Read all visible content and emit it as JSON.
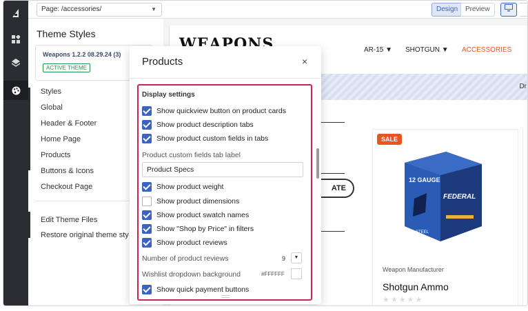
{
  "topbar": {
    "page_select": "Page: /accessories/",
    "design_label": "Design",
    "preview_label": "Preview"
  },
  "sidebar": {
    "title": "Theme Styles",
    "theme_name": "Weapons 1.2.2 08.29.24 (3)",
    "active_badge": "ACTIVE THEME",
    "items": [
      {
        "label": "Styles"
      },
      {
        "label": "Global"
      },
      {
        "label": "Header & Footer"
      },
      {
        "label": "Home Page"
      },
      {
        "label": "Products"
      },
      {
        "label": "Buttons & Icons"
      },
      {
        "label": "Checkout Page"
      },
      {
        "label": "Edit Theme Files"
      },
      {
        "label": "Restore original theme sty"
      }
    ]
  },
  "store": {
    "logo": "WEAPONS",
    "nav": [
      "AR-15 ▼",
      "SHOTGUN ▼",
      "ACCESSORIES"
    ],
    "stripe_text": "Dr",
    "button_fragment": "ATE",
    "product": {
      "badge": "SALE",
      "manufacturer": "Weapon Manufacturer",
      "name": "Shotgun Ammo",
      "stars": "★★★★★",
      "box_brand": "FEDERAL",
      "box_gauge": "12 GAUGE",
      "box_bottom": "2¾ STEEL"
    }
  },
  "modal": {
    "title": "Products",
    "close_icon": "×",
    "section_title": "Display settings",
    "options_top": [
      {
        "label": "Show quickview button on product cards",
        "checked": true
      },
      {
        "label": "Show product description tabs",
        "checked": true
      },
      {
        "label": "Show product custom fields in tabs",
        "checked": true
      }
    ],
    "custom_tab_label": "Product custom fields tab label",
    "custom_tab_value": "Product Specs",
    "options_bottom": [
      {
        "label": "Show product weight",
        "checked": true
      },
      {
        "label": "Show product dimensions",
        "checked": false
      },
      {
        "label": "Show product swatch names",
        "checked": true
      },
      {
        "label": "Show \"Shop by Price\" in filters",
        "checked": true
      },
      {
        "label": "Show product reviews",
        "checked": true
      }
    ],
    "reviews_count_label": "Number of product reviews",
    "reviews_count_value": "9",
    "reviews_caret": "▼",
    "wishlist_label": "Wishlist dropdown background",
    "wishlist_color": "#FFFFFF",
    "quick_payment": {
      "label": "Show quick payment buttons",
      "checked": true
    }
  },
  "colors": {
    "accent_blue": "#3b63c4",
    "highlight": "#cc2258",
    "nav_accent": "#e8551e"
  }
}
